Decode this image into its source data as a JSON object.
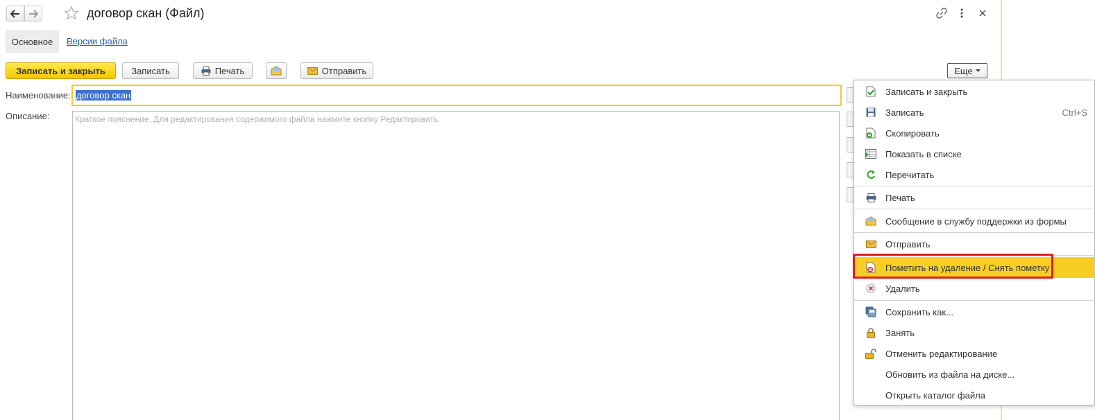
{
  "header": {
    "title": "договор скан (Файл)"
  },
  "tabs": {
    "main": "Основное",
    "versions": "Версии файла"
  },
  "toolbar": {
    "save_close": "Записать и закрыть",
    "save": "Записать",
    "print": "Печать",
    "send": "Отправить",
    "more": "Еще"
  },
  "form": {
    "name_label": "Наименование:",
    "name_value": "договор скан",
    "desc_label": "Описание:",
    "desc_placeholder": "Краткое пояснение. Для редактирования содержимого файла нажмите кнопку Редактировать."
  },
  "menu": {
    "items": [
      {
        "label": "Записать и закрыть",
        "icon": "save-close-icon"
      },
      {
        "label": "Записать",
        "shortcut": "Ctrl+S",
        "icon": "floppy-icon"
      },
      {
        "label": "Скопировать",
        "icon": "copy-icon"
      },
      {
        "label": "Показать в списке",
        "icon": "show-in-list-icon"
      },
      {
        "label": "Перечитать",
        "icon": "refresh-icon"
      },
      {
        "label": "Печать",
        "icon": "printer-icon"
      },
      {
        "label": "Сообщение в службу поддержки из формы",
        "icon": "support-message-icon"
      },
      {
        "label": "Отправить",
        "icon": "envelope-icon"
      },
      {
        "label": "Пометить на удаление / Снять пометку",
        "icon": "mark-delete-icon"
      },
      {
        "label": "Удалить",
        "icon": "delete-icon"
      },
      {
        "label": "Сохранить как...",
        "icon": "save-as-icon"
      },
      {
        "label": "Занять",
        "icon": "lock-icon"
      },
      {
        "label": "Отменить редактирование",
        "icon": "unlock-icon"
      },
      {
        "label": "Обновить из файла на диске...",
        "icon": ""
      },
      {
        "label": "Открыть каталог файла",
        "icon": ""
      }
    ],
    "highlighted_index": 8
  },
  "colors": {
    "primary": "#f5c700",
    "highlight": "#f7ce25",
    "annotation": "#e01b1b",
    "link": "#1f5fa8"
  }
}
